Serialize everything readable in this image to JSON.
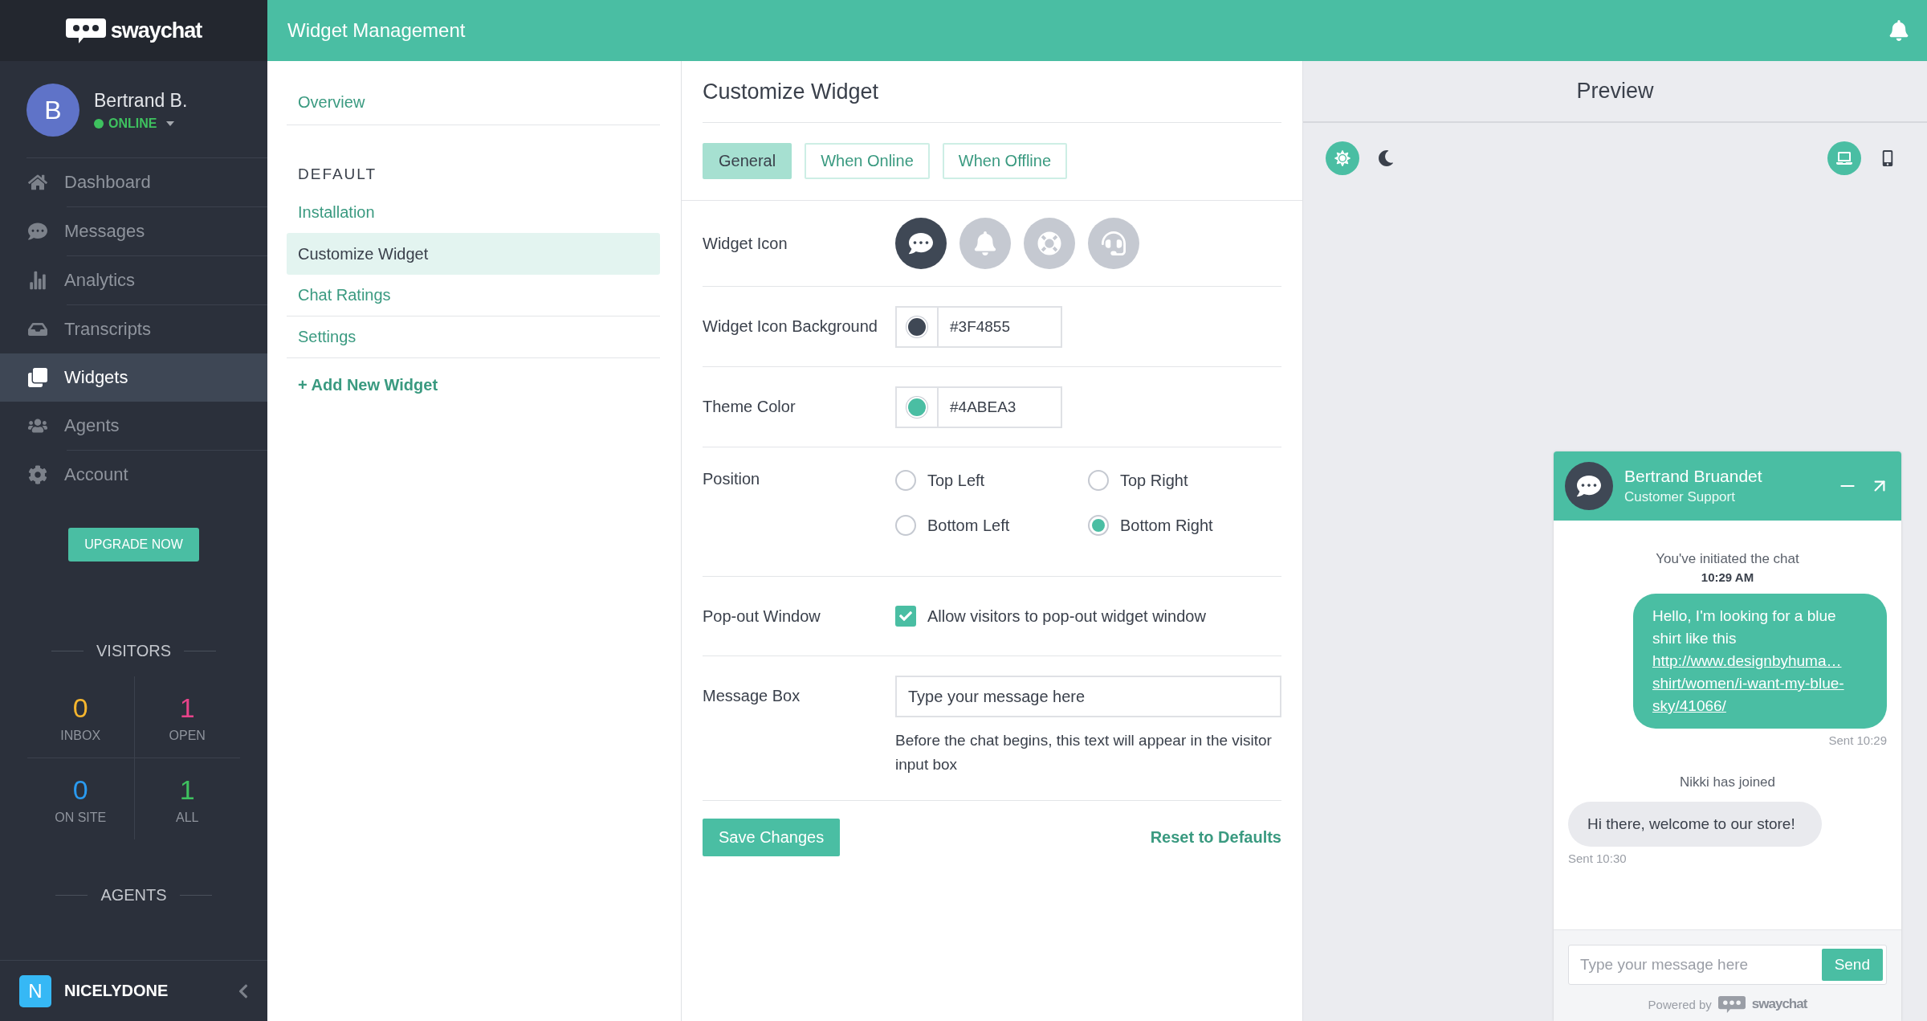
{
  "sidebar": {
    "brand": "swaychat",
    "profile": {
      "initial": "B",
      "name": "Bertrand B.",
      "status": "ONLINE"
    },
    "nav": [
      {
        "kind": "home",
        "label": "Dashboard",
        "selected": false
      },
      {
        "kind": "messages",
        "label": "Messages",
        "selected": false
      },
      {
        "kind": "analytics",
        "label": "Analytics",
        "selected": false
      },
      {
        "kind": "transcripts",
        "label": "Transcripts",
        "selected": false
      },
      {
        "kind": "widgets",
        "label": "Widgets",
        "selected": true
      },
      {
        "kind": "agents",
        "label": "Agents",
        "selected": false
      },
      {
        "kind": "account",
        "label": "Account",
        "selected": false
      }
    ],
    "upgrade_button": "UPGRADE NOW",
    "visitors": {
      "title": "VISITORS",
      "stats": [
        {
          "value": "0",
          "label": "INBOX",
          "color": "#f5b52e"
        },
        {
          "value": "1",
          "label": "OPEN",
          "color": "#e8438a"
        },
        {
          "value": "0",
          "label": "ON SITE",
          "color": "#2a9af0"
        },
        {
          "value": "1",
          "label": "ALL",
          "color": "#3ec15f"
        }
      ]
    },
    "agents": {
      "title": "AGENTS"
    },
    "workspace": {
      "initial": "N",
      "name": "NICELYDONE"
    }
  },
  "header": {
    "title": "Widget Management"
  },
  "widget_nav": {
    "top": [
      "Overview"
    ],
    "section": "DEFAULT",
    "items": [
      {
        "label": "Installation",
        "selected": false
      },
      {
        "label": "Customize Widget",
        "selected": true
      },
      {
        "label": "Chat Ratings",
        "selected": false
      },
      {
        "label": "Settings",
        "selected": false
      }
    ],
    "add": "+ Add New Widget"
  },
  "form": {
    "title": "Customize Widget",
    "tabs": [
      {
        "label": "General",
        "selected": true
      },
      {
        "label": "When Online",
        "selected": false
      },
      {
        "label": "When Offline",
        "selected": false
      }
    ],
    "widget_icon": {
      "label": "Widget Icon",
      "options": [
        {
          "kind": "chat",
          "selected": true
        },
        {
          "kind": "bell",
          "selected": false
        },
        {
          "kind": "lifebuoy",
          "selected": false
        },
        {
          "kind": "agent",
          "selected": false
        }
      ]
    },
    "icon_background": {
      "label": "Widget Icon Background",
      "value": "#3F4855"
    },
    "theme_color": {
      "label": "Theme Color",
      "value": "#4ABEA3"
    },
    "position": {
      "label": "Position",
      "options": [
        {
          "label": "Top Left",
          "selected": false
        },
        {
          "label": "Top Right",
          "selected": false
        },
        {
          "label": "Bottom Left",
          "selected": false
        },
        {
          "label": "Bottom Right",
          "selected": true
        }
      ]
    },
    "popout": {
      "label": "Pop-out Window",
      "text": "Allow visitors to pop-out widget window",
      "checked": true
    },
    "message_box": {
      "label": "Message Box",
      "value": "Type your message here",
      "help": "Before the chat begins, this text will appear in the visitor input box"
    },
    "save": "Save Changes",
    "reset": "Reset to Defaults"
  },
  "preview": {
    "title": "Preview",
    "themes": [
      {
        "kind": "light",
        "selected": true
      },
      {
        "kind": "dark",
        "selected": false
      }
    ],
    "devices": [
      {
        "kind": "desktop",
        "selected": true
      },
      {
        "kind": "mobile",
        "selected": false
      }
    ],
    "chat": {
      "agent": "Bertrand Bruandet",
      "role": "Customer Support",
      "messages": [
        {
          "kind": "system",
          "text": "You've initiated the chat",
          "time": "10:29 AM"
        },
        {
          "kind": "outgoing",
          "text": "Hello, I'm looking for a blue shirt like this",
          "link": "http://www.designbyhuma…shirt/women/i-want-my-blue-sky/41066/",
          "time": "Sent 10:29"
        },
        {
          "kind": "system",
          "text": "Nikki has joined"
        },
        {
          "kind": "incoming",
          "text": "Hi there, welcome to our store!",
          "time": "Sent 10:30"
        }
      ],
      "input_placeholder": "Type your message here",
      "send": "Send",
      "powered_by": "Powered by",
      "brand": "swaychat"
    }
  }
}
